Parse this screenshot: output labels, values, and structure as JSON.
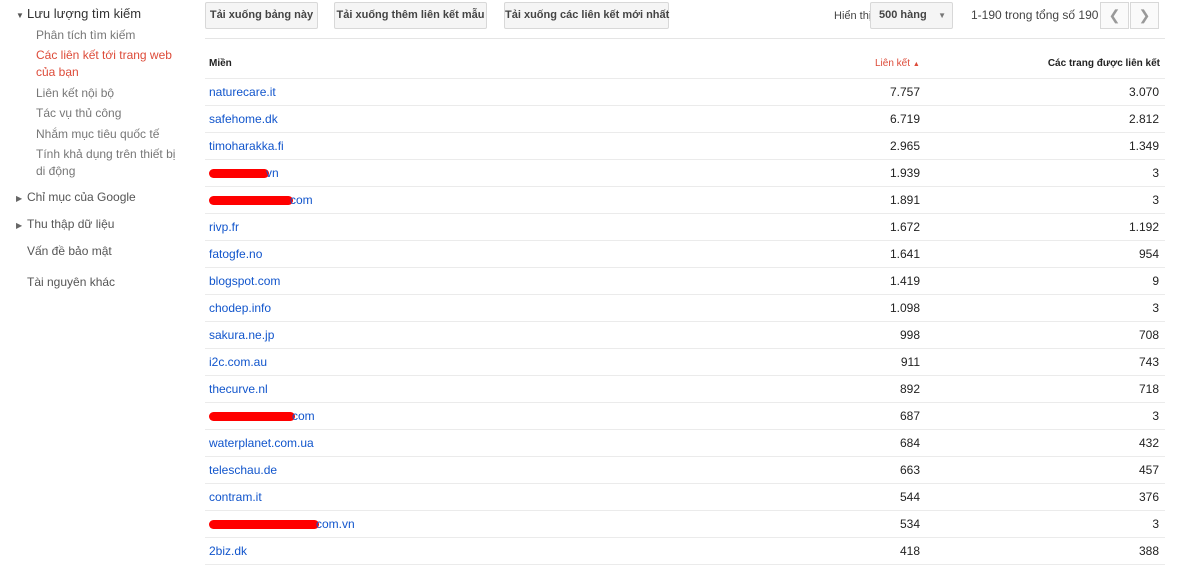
{
  "sidebar": {
    "search_traffic": "Lưu lượng tìm kiếm",
    "sub_items": [
      {
        "label": "Phân tích tìm kiếm"
      },
      {
        "label": "Các liên kết tới trang web của bạn"
      },
      {
        "label": "Liên kết nội bộ"
      },
      {
        "label": "Tác vụ thủ công"
      },
      {
        "label": "Nhắm mục tiêu quốc tế"
      },
      {
        "label": "Tính khả dụng trên thiết bị di động"
      }
    ],
    "google_index": "Chỉ mục của Google",
    "crawl": "Thu thập dữ liệu",
    "security": "Vấn đề bảo mật",
    "other": "Tài nguyên khác"
  },
  "toolbar": {
    "download_table": "Tải xuống bảng này",
    "download_more_links": "Tải xuống thêm liên kết mẫu",
    "download_latest": "Tải xuống các liên kết mới nhất",
    "show_label": "Hiển thị",
    "rows_select": "500 hàng",
    "range": "1-190 trong tổng số 190"
  },
  "table": {
    "headers": {
      "domain": "Miền",
      "links": "Liên kết",
      "pages": "Các trang được liên kết"
    },
    "rows": [
      {
        "domain": "naturecare.it",
        "links": "7.757",
        "pages": "3.070"
      },
      {
        "domain": "safehome.dk",
        "links": "6.719",
        "pages": "2.812"
      },
      {
        "domain": "timoharakka.fi",
        "links": "2.965",
        "pages": "1.349"
      },
      {
        "domain": "vn",
        "links": "1.939",
        "pages": "3"
      },
      {
        "domain": "com",
        "links": "1.891",
        "pages": "3"
      },
      {
        "domain": "rivp.fr",
        "links": "1.672",
        "pages": "1.192"
      },
      {
        "domain": "fatogfe.no",
        "links": "1.641",
        "pages": "954"
      },
      {
        "domain": "blogspot.com",
        "links": "1.419",
        "pages": "9"
      },
      {
        "domain": "chodep.info",
        "links": "1.098",
        "pages": "3"
      },
      {
        "domain": "sakura.ne.jp",
        "links": "998",
        "pages": "708"
      },
      {
        "domain": "i2c.com.au",
        "links": "911",
        "pages": "743"
      },
      {
        "domain": "thecurve.nl",
        "links": "892",
        "pages": "718"
      },
      {
        "domain": "com",
        "links": "687",
        "pages": "3"
      },
      {
        "domain": "waterplanet.com.ua",
        "links": "684",
        "pages": "432"
      },
      {
        "domain": "teleschau.de",
        "links": "663",
        "pages": "457"
      },
      {
        "domain": "contram.it",
        "links": "544",
        "pages": "376"
      },
      {
        "domain": "com.vn",
        "links": "534",
        "pages": "3"
      },
      {
        "domain": "2biz.dk",
        "links": "418",
        "pages": "388"
      }
    ]
  },
  "colors": {
    "link": "#1155cc",
    "accent_red": "#dd4b39",
    "redaction": "#ff0000"
  }
}
